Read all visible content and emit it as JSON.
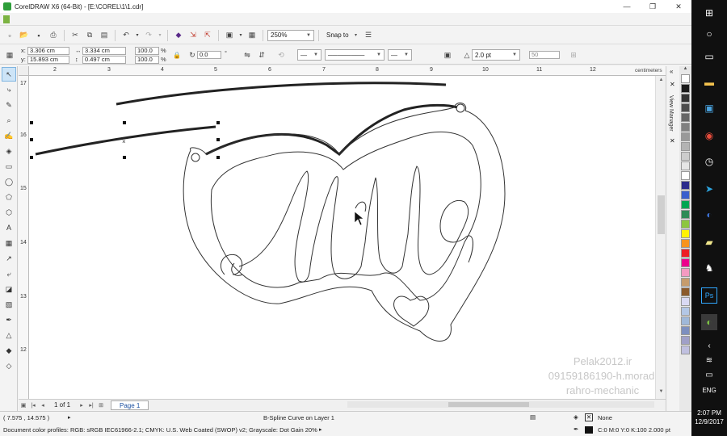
{
  "window": {
    "title": "CorelDRAW X6 (64-Bit) - [E:\\COREL\\1\\1.cdr]",
    "minimize": "—",
    "restore": "❐",
    "close": "✕"
  },
  "toolbar": {
    "zoom_value": "250%",
    "snap_to_label": "Snap to"
  },
  "propbar": {
    "x_label": "x:",
    "x_value": "3.306 cm",
    "y_label": "y:",
    "y_value": "15.893 cm",
    "width_value": "3.334 cm",
    "height_value": "0.497 cm",
    "scale_x": "100.0",
    "scale_y": "100.0",
    "percent_symbol": "%",
    "rotation_value": "0.0",
    "degree_symbol": "°",
    "outline_width": "2.0 pt",
    "smoothing_value": "50"
  },
  "ruler": {
    "units": "centimeters",
    "top_ticks": [
      "2",
      "3",
      "4",
      "5",
      "6",
      "7",
      "8",
      "9",
      "10",
      "11",
      "12"
    ],
    "left_ticks": [
      "17",
      "16",
      "15",
      "14",
      "13",
      "12"
    ]
  },
  "canvas": {
    "watermark_line1": "Pelak2012.ir",
    "watermark_line2": "09159186190-h.moradi",
    "watermark_line3": "rahro-mechanic"
  },
  "docker": {
    "label": "View Manager"
  },
  "pagebar": {
    "page_count": "1 of 1",
    "page_tab": "Page 1"
  },
  "status": {
    "cursor_position": "( 7.575 , 14.575 )",
    "object_info": "B-Spline Curve on Layer 1",
    "color_profiles": "Document color profiles: RGB: sRGB IEC61966-2.1; CMYK: U.S. Web Coated (SWOP) v2; Grayscale: Dot Gain 20%",
    "fill_label": "None",
    "outline_info": "C:0 M:0 Y:0 K:100  2.000 pt"
  },
  "taskbar": {
    "time": "2:07 PM",
    "date": "12/9/2017",
    "language": "ENG"
  },
  "palette_colors": [
    "#ffffff",
    "#1a1a1a",
    "#333333",
    "#4d4d4d",
    "#666666",
    "#808080",
    "#999999",
    "#b3b3b3",
    "#cccccc",
    "#e6e6e6",
    "#ffffff",
    "#2b2b8c",
    "#3a5fcd",
    "#00a651",
    "#2e8b57",
    "#8dc63f",
    "#fff200",
    "#f7941d",
    "#ed1c24",
    "#ec008c",
    "#f49ac1",
    "#c69c6d",
    "#8b5a2b",
    "#d9d9f3",
    "#b3c7e6",
    "#9fb8d9",
    "#7d8fbf",
    "#a0a0c8",
    "#c0c0e0"
  ]
}
